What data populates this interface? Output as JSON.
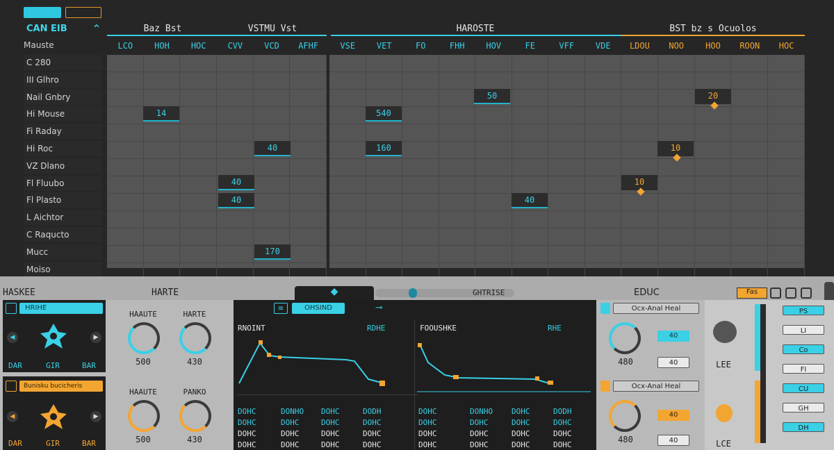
{
  "topbar": {
    "btn1": "",
    "btn2": ""
  },
  "seq": {
    "title_left": "CAN EIB",
    "header_label": "Mauste",
    "sections": [
      "Baz Bst",
      "VSTMU Vst",
      "HAROSTE",
      "BST bz s Ocuolos"
    ],
    "cols_a": [
      "LCO",
      "HOH",
      "HOC",
      "CVV",
      "VCD",
      "AFHF"
    ],
    "cols_b": [
      "VSE",
      "VET",
      "FO",
      "FHH",
      "HOV",
      "FE",
      "VFF",
      "VDE"
    ],
    "cols_c": [
      "LDOU",
      "NOO",
      "HOO",
      "ROON",
      "HOC"
    ],
    "rows": [
      "C 280",
      "III Glhro",
      "Nail Gnbry",
      "Hi Mouse",
      "Fi Raday",
      "Hi Roc",
      "VZ Dlano",
      "Fl Fluubo",
      "Fl Plasto",
      "L Aichtor",
      "C Raqucto",
      "Mucc",
      "Moiso"
    ],
    "steps_cyan": [
      "14",
      "40",
      "40",
      "40",
      "540",
      "50",
      "160",
      "40",
      "170"
    ],
    "steps_orange": [
      "20",
      "10",
      "10"
    ]
  },
  "lower": {
    "header_left": "HASKEE",
    "header_mid": "HARTE",
    "header_center": "GHTRISE",
    "header_right": "EDUC",
    "inst1_name": "HRIHE",
    "inst2_name": "Bunisku bucicheris",
    "inst_footer": [
      "DAR",
      "GIR",
      "BAR"
    ],
    "knob_labels_top": [
      "HAAUTE",
      "HARTE"
    ],
    "knob_labels_bot": [
      "HAAUTE",
      "PANKO"
    ],
    "knob_values_top": [
      "500",
      "430"
    ],
    "knob_values_bot": [
      "500",
      "430"
    ],
    "env_tab": "OHSIND",
    "env1_title": "RNOINT",
    "env1_mode": "RDHE",
    "env2_title": "FOOUSHKE",
    "env2_mode": "RHE",
    "env_rows": [
      [
        "DOHC",
        "DONHO",
        "DOHC",
        "DODH"
      ],
      [
        "DOHC",
        "DOHC",
        "DOHC",
        "DOHC"
      ],
      [
        "DOHC",
        "DOHC",
        "DOHC",
        "DOHC"
      ],
      [
        "DOHC",
        "DOHC",
        "DOHC",
        "DOHC"
      ]
    ],
    "right_header1": "Ocx-Anal Heal",
    "right_header2": "Ocx-Anal Heal",
    "right_val1": "480",
    "right_val2": "480",
    "right_small": [
      "40",
      "40",
      "40",
      "40"
    ],
    "fx_top": "Fas",
    "fx_label": "LEE",
    "fx_label2": "LCE",
    "mixer_items": [
      "PS",
      "LI",
      "Co",
      "FI",
      "CU",
      "GH",
      "DH"
    ]
  },
  "colors": {
    "accent": "#22c4dc",
    "orange": "#f3a532",
    "dark": "#262626"
  }
}
